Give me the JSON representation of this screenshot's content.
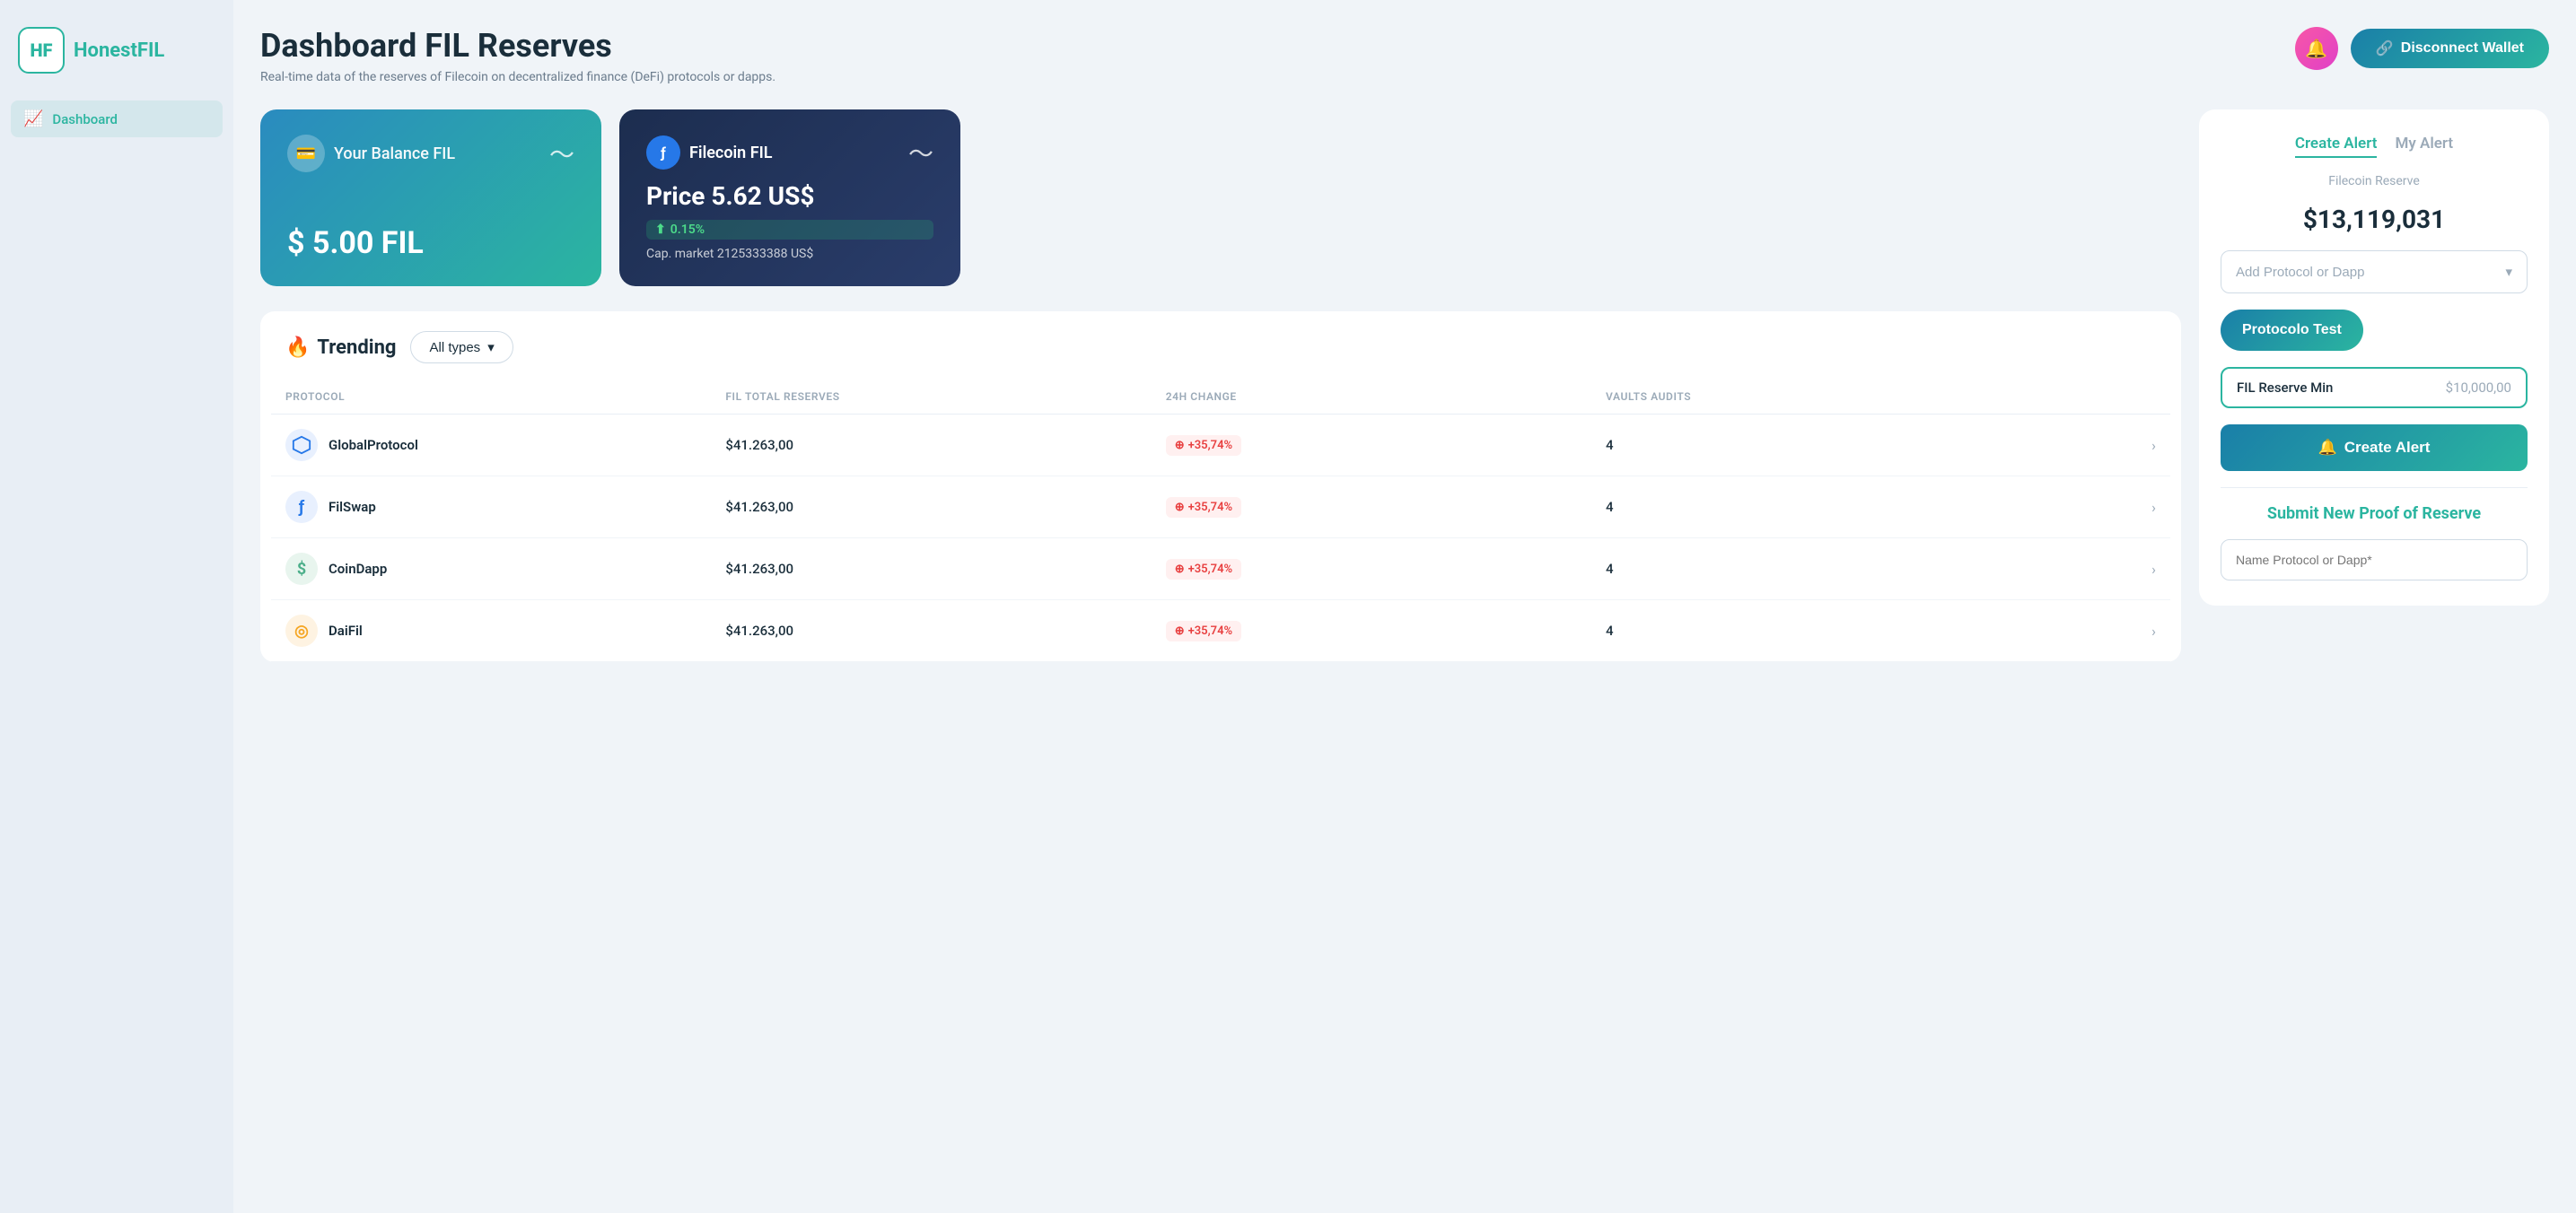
{
  "sidebar": {
    "logo_letters": "HF",
    "logo_name_prefix": "Honest",
    "logo_name_suffix": "FIL",
    "nav_items": [
      {
        "id": "dashboard",
        "label": "Dashboard",
        "icon": "📈",
        "active": true
      }
    ]
  },
  "header": {
    "title": "Dashboard FIL Reserves",
    "subtitle": "Real-time data of the reserves of Filecoin on decentralized finance (DeFi) protocols or dapps.",
    "disconnect_button": "Disconnect Wallet",
    "wallet_icon": "🔗"
  },
  "balance_card": {
    "label": "Your Balance FIL",
    "amount": "$ 5.00 FIL",
    "icon": "💳"
  },
  "filecoin_card": {
    "name": "Filecoin FIL",
    "price": "Price 5.62 US$",
    "change": "0.15%",
    "cap_market": "Cap. market 2125333388 US$"
  },
  "trending": {
    "title": "Trending",
    "fire_icon": "🔥",
    "filter_label": "All types",
    "filter_chevron": "▾"
  },
  "table": {
    "headers": [
      "PROTOCOL",
      "FIL TOTAL RESERVES",
      "24H CHANGE",
      "VAULTS AUDITS",
      ""
    ],
    "rows": [
      {
        "name": "GlobalProtocol",
        "icon": "⬡",
        "icon_color": "#2678e8",
        "reserves": "$41.263,00",
        "change": "+35,74%",
        "audits": "4"
      },
      {
        "name": "FilSwap",
        "icon": "ƒ",
        "icon_color": "#2678e8",
        "reserves": "$41.263,00",
        "change": "+35,74%",
        "audits": "4"
      },
      {
        "name": "CoinDapp",
        "icon": "$",
        "icon_color": "#4caf8a",
        "reserves": "$41.263,00",
        "change": "+35,74%",
        "audits": "4"
      },
      {
        "name": "DaiFil",
        "icon": "◎",
        "icon_color": "#f5a623",
        "reserves": "$41.263,00",
        "change": "+35,74%",
        "audits": "4"
      }
    ]
  },
  "right_panel": {
    "tab_create": "Create Alert",
    "tab_my_alert": "My Alert",
    "reserve_label": "Filecoin Reserve",
    "reserve_value": "$13,119,031",
    "add_protocol_placeholder": "Add Protocol or Dapp",
    "protocolo_button": "Protocolo Test",
    "reserve_input_label": "FIL Reserve Min",
    "reserve_input_value": "$10,000,00",
    "create_alert_button": "Create Alert",
    "bell_icon": "🔔",
    "submit_title": "Submit New Proof of Reserve",
    "name_protocol_placeholder": "Name Protocol or Dapp*"
  }
}
